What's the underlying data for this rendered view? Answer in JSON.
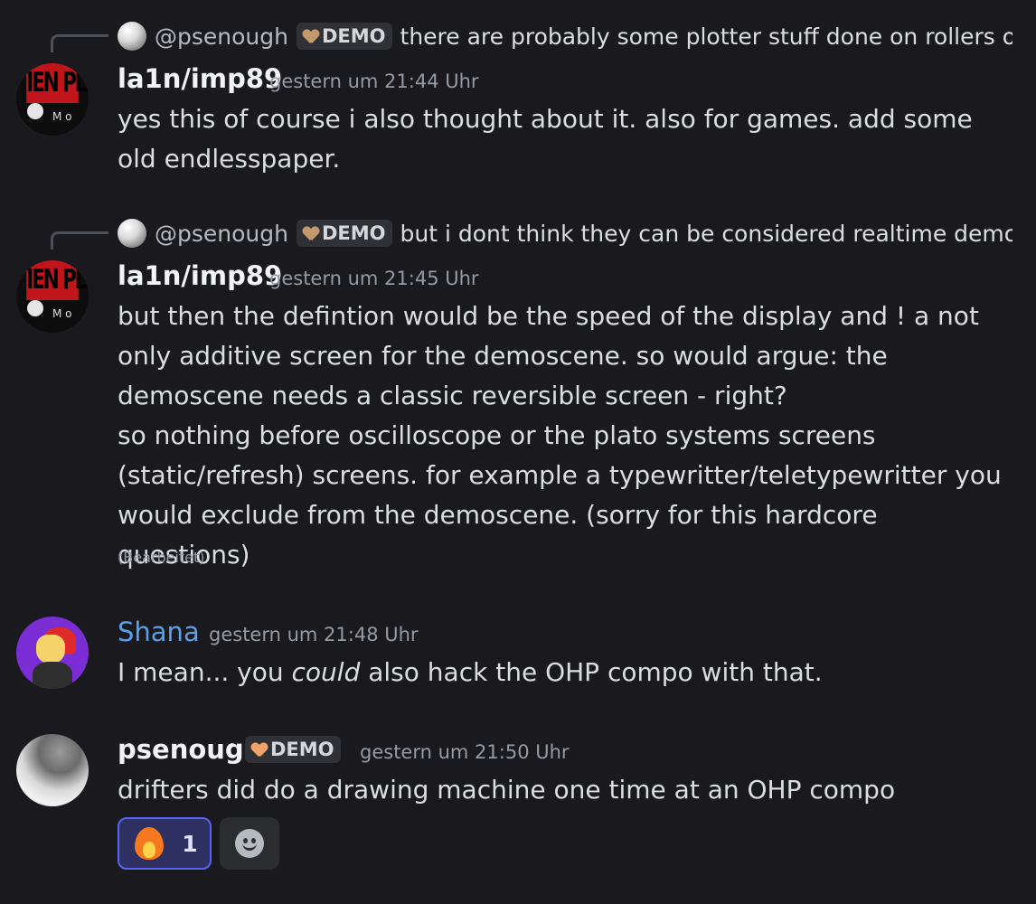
{
  "messages": [
    {
      "reply": {
        "username": "@psenough",
        "tag": "DEMO",
        "text": "there are probably some plotter stuff done on rollers o..."
      },
      "author": "la1n/imp89",
      "timestamp": "gestern um 21:44 Uhr",
      "text": "yes this of course i also thought about it. also for games. add some old endlesspaper."
    },
    {
      "reply": {
        "username": "@psenough",
        "tag": "DEMO",
        "text": "but i dont think they can be considered realtime demo..."
      },
      "author": "la1n/imp89",
      "timestamp": "gestern um 21:45 Uhr",
      "lines": [
        "but then the defintion would be the speed of the display and ! a not only additive screen for the demoscene. so would argue: the demoscene needs a classic reversible screen - right?",
        "so nothing before oscilloscope or the plato systems screens (static/refresh) screens. for example a typewritter/teletypewritter you would exclude from the demoscene. (sorry for this hardcore questions)"
      ],
      "edited": "(Bearbeitet)"
    },
    {
      "author": "Shana",
      "timestamp": "gestern um 21:48 Uhr",
      "text_before": "I mean... you ",
      "text_em": "could",
      "text_after": " also hack the OHP compo with that."
    },
    {
      "author": "psenough",
      "tag": "DEMO",
      "timestamp": "gestern um 21:50 Uhr",
      "text": "drifters did do a drawing machine one time at an OHP compo",
      "reaction": {
        "emoji": "fire-icon",
        "count": "1"
      }
    }
  ],
  "avatar_text": {
    "lain": "IEN PLA",
    "lain_small": "M o"
  },
  "colors": {
    "background": "#1a1a1e",
    "accent": "#5865f2",
    "shana_name": "#5b9fe8"
  }
}
